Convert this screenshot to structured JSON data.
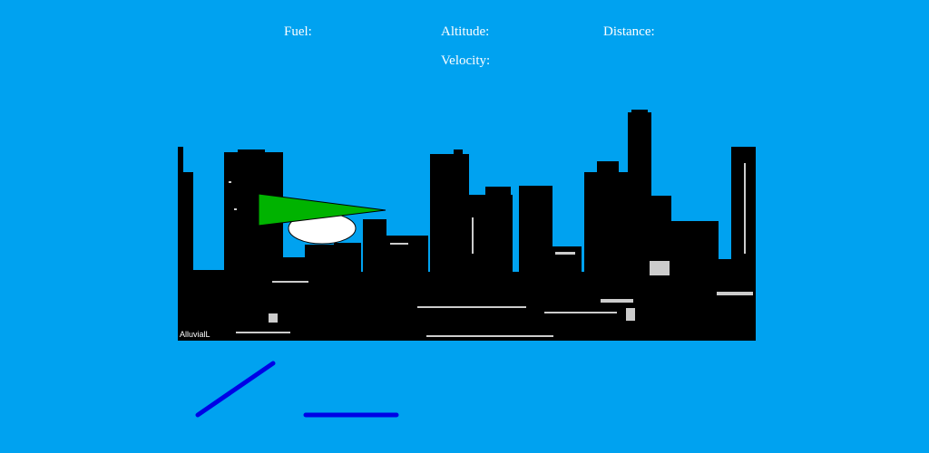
{
  "hud": {
    "fuel_label": "Fuel:",
    "altitude_label": "Altitude:",
    "distance_label": "Distance:",
    "velocity_label": "Velocity:"
  },
  "skyline": {
    "watermark": "AlluvialL"
  },
  "colors": {
    "sky": "#00a2f0",
    "skyline": "#000000",
    "plane_wing": "#00b300",
    "plane_body": "#ffffff",
    "launch_ramp": "#0000e6"
  },
  "objects": {
    "plane_icon": "glider-plane-icon",
    "ramp_icon": "launch-ramp-icon"
  }
}
